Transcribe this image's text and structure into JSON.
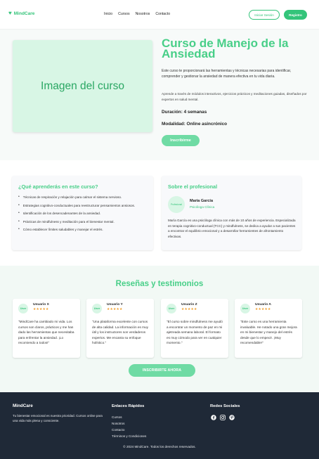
{
  "header": {
    "brand": "MindCare",
    "nav": [
      "Inicio",
      "Cursos",
      "Nosotros",
      "Contacto"
    ],
    "login_label": "Iniciar Sesión",
    "register_label": "Registro"
  },
  "hero": {
    "image_label": "Imagen del curso",
    "title": "Curso de Manejo de la Ansiedad",
    "description": "Este curso te proporcionará las herramientas y técnicas necesarias para identificar, comprender y gestionar la ansiedad de manera efectiva en tu vida diaria.",
    "description2": "Aprende a través de módulos interactivos, ejercicios prácticos y meditaciones guiadas, diseñados por expertos en salud mental.",
    "duration": "Duración: 4 semanas",
    "modality": "Modalidad: Online asincrónico",
    "enroll_label": "Inscribirme"
  },
  "learn": {
    "title": "¿Qué aprenderás en este curso?",
    "items": [
      "Técnicas de respiración y relajación para calmar el sistema nervioso.",
      "Estrategias cognitivo-conductuales para reestructurar pensamientos ansiosos.",
      "Identificación de los desencadenantes de la ansiedad.",
      "Prácticas de mindfulness y meditación para el bienestar mental.",
      "Cómo establecer límites saludables y manejar el estrés."
    ]
  },
  "professional": {
    "title": "Sobre el profesional",
    "avatar_label": "Profesional",
    "name": "María García",
    "role": "Psicóloga Clínica",
    "bio": "María García es una psicóloga clínica con más de 10 años de experiencia. Especializada en terapia cognitivo-conductual (TCC) y mindfulness, se dedica a ayudar a sus pacientes a encontrar el equilibrio emocional y a desarrollar herramientes de afrontamiento efectivas."
  },
  "testimonials": {
    "title": "Reseñas y testimonios",
    "avatar_label": "User",
    "stars": "★★★★★",
    "reviews": [
      {
        "user": "Usuario X",
        "text": "\"MindCare ha cambiado mi vida. Los cursos son claros, prácticos y me han dado las herramientas que necesitaba para enfrentar la ansiedad. ¡Lo recomiendo a todos!\""
      },
      {
        "user": "Usuario Y",
        "text": "\"Una plataforma excelente con cursos de alta calidad. La información es muy útil y los instructores son verdaderos expertos. Me encanta su enfoque holístico.\""
      },
      {
        "user": "Usuario Z",
        "text": "\"El curso sobre mindfulness me ayudó a encontrar un momento de paz en mi ajetreada semana laboral. El formato es muy cómodo para ver en cualquier momento.\""
      },
      {
        "user": "Usuario A",
        "text": "\"Este curso es una herramienta invaluable. He notado una gran mejora en mi bienestar y manejo del estrés desde que lo empecé. ¡Muy recomendable!\""
      }
    ],
    "cta_label": "INSCRIBIRTE AHORA"
  },
  "footer": {
    "brand": "MindCare",
    "tagline": "Tu bienestar emocional es nuestra prioridad. Cursos online para una vida más plena y consciente.",
    "links_title": "Enlaces Rápidos",
    "links": [
      "Cursos",
      "Nosotros",
      "Contacto",
      "Términos y Condiciones"
    ],
    "social_title": "Redes Sociales",
    "social_icons": [
      "facebook-icon",
      "instagram-icon",
      "pinterest-icon"
    ],
    "copyright": "© 2024 MindCare. Todos los derechos reservados."
  },
  "colors": {
    "accent": "#34c47a",
    "accent_light": "#6fdba4",
    "footer_bg": "#1f2937",
    "star": "#f0a030"
  }
}
